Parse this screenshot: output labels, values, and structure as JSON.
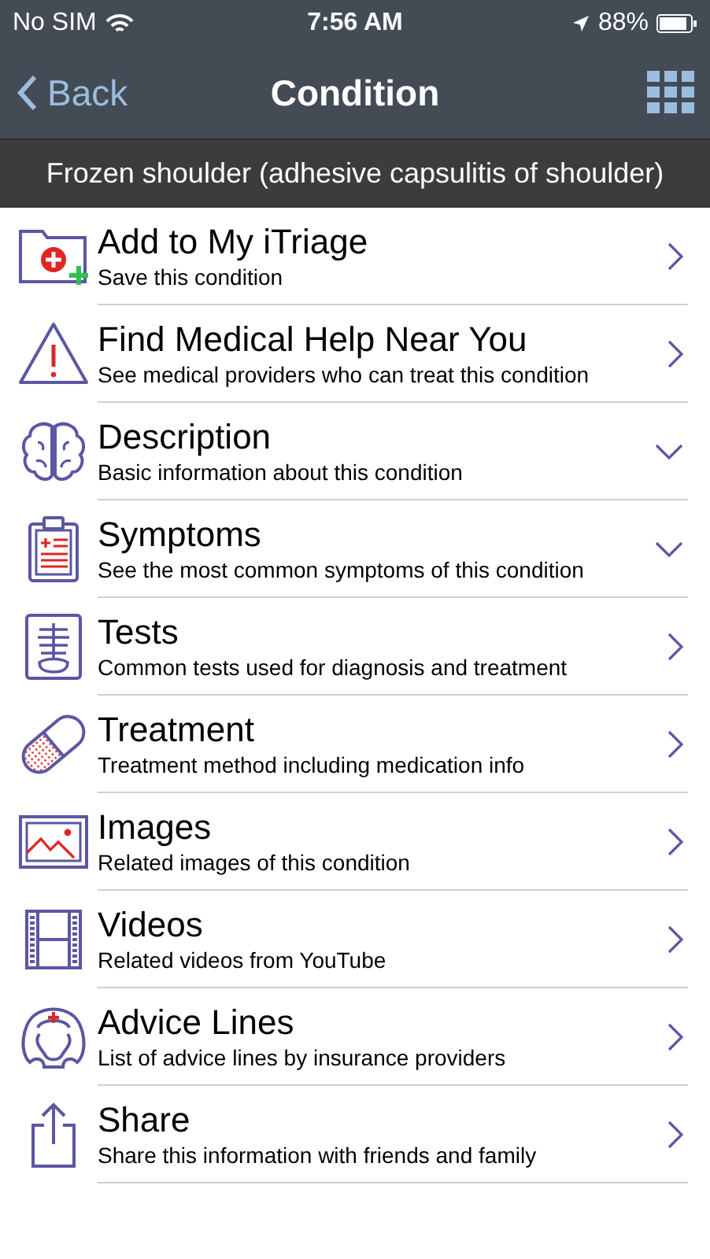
{
  "status_bar": {
    "carrier": "No SIM",
    "time": "7:56 AM",
    "battery": "88%"
  },
  "nav": {
    "back": "Back",
    "title": "Condition"
  },
  "condition": "Frozen shoulder (adhesive capsulitis of shoulder)",
  "items": [
    {
      "title": "Add to My iTriage",
      "subtitle": "Save this condition",
      "kind": "link"
    },
    {
      "title": "Find Medical Help Near You",
      "subtitle": "See medical providers who can treat this condition",
      "kind": "link"
    },
    {
      "title": "Description",
      "subtitle": "Basic information about this condition",
      "kind": "expandable"
    },
    {
      "title": "Symptoms",
      "subtitle": "See the most common symptoms of this condition",
      "kind": "expandable"
    },
    {
      "title": "Tests",
      "subtitle": "Common tests used for diagnosis and treatment",
      "kind": "link"
    },
    {
      "title": "Treatment",
      "subtitle": "Treatment method including medication info",
      "kind": "link"
    },
    {
      "title": "Images",
      "subtitle": "Related images of this condition",
      "kind": "link"
    },
    {
      "title": "Videos",
      "subtitle": "Related videos from YouTube",
      "kind": "link"
    },
    {
      "title": "Advice Lines",
      "subtitle": "List of advice lines by insurance providers",
      "kind": "link"
    },
    {
      "title": "Share",
      "subtitle": "Share this information with friends and family",
      "kind": "link"
    }
  ]
}
